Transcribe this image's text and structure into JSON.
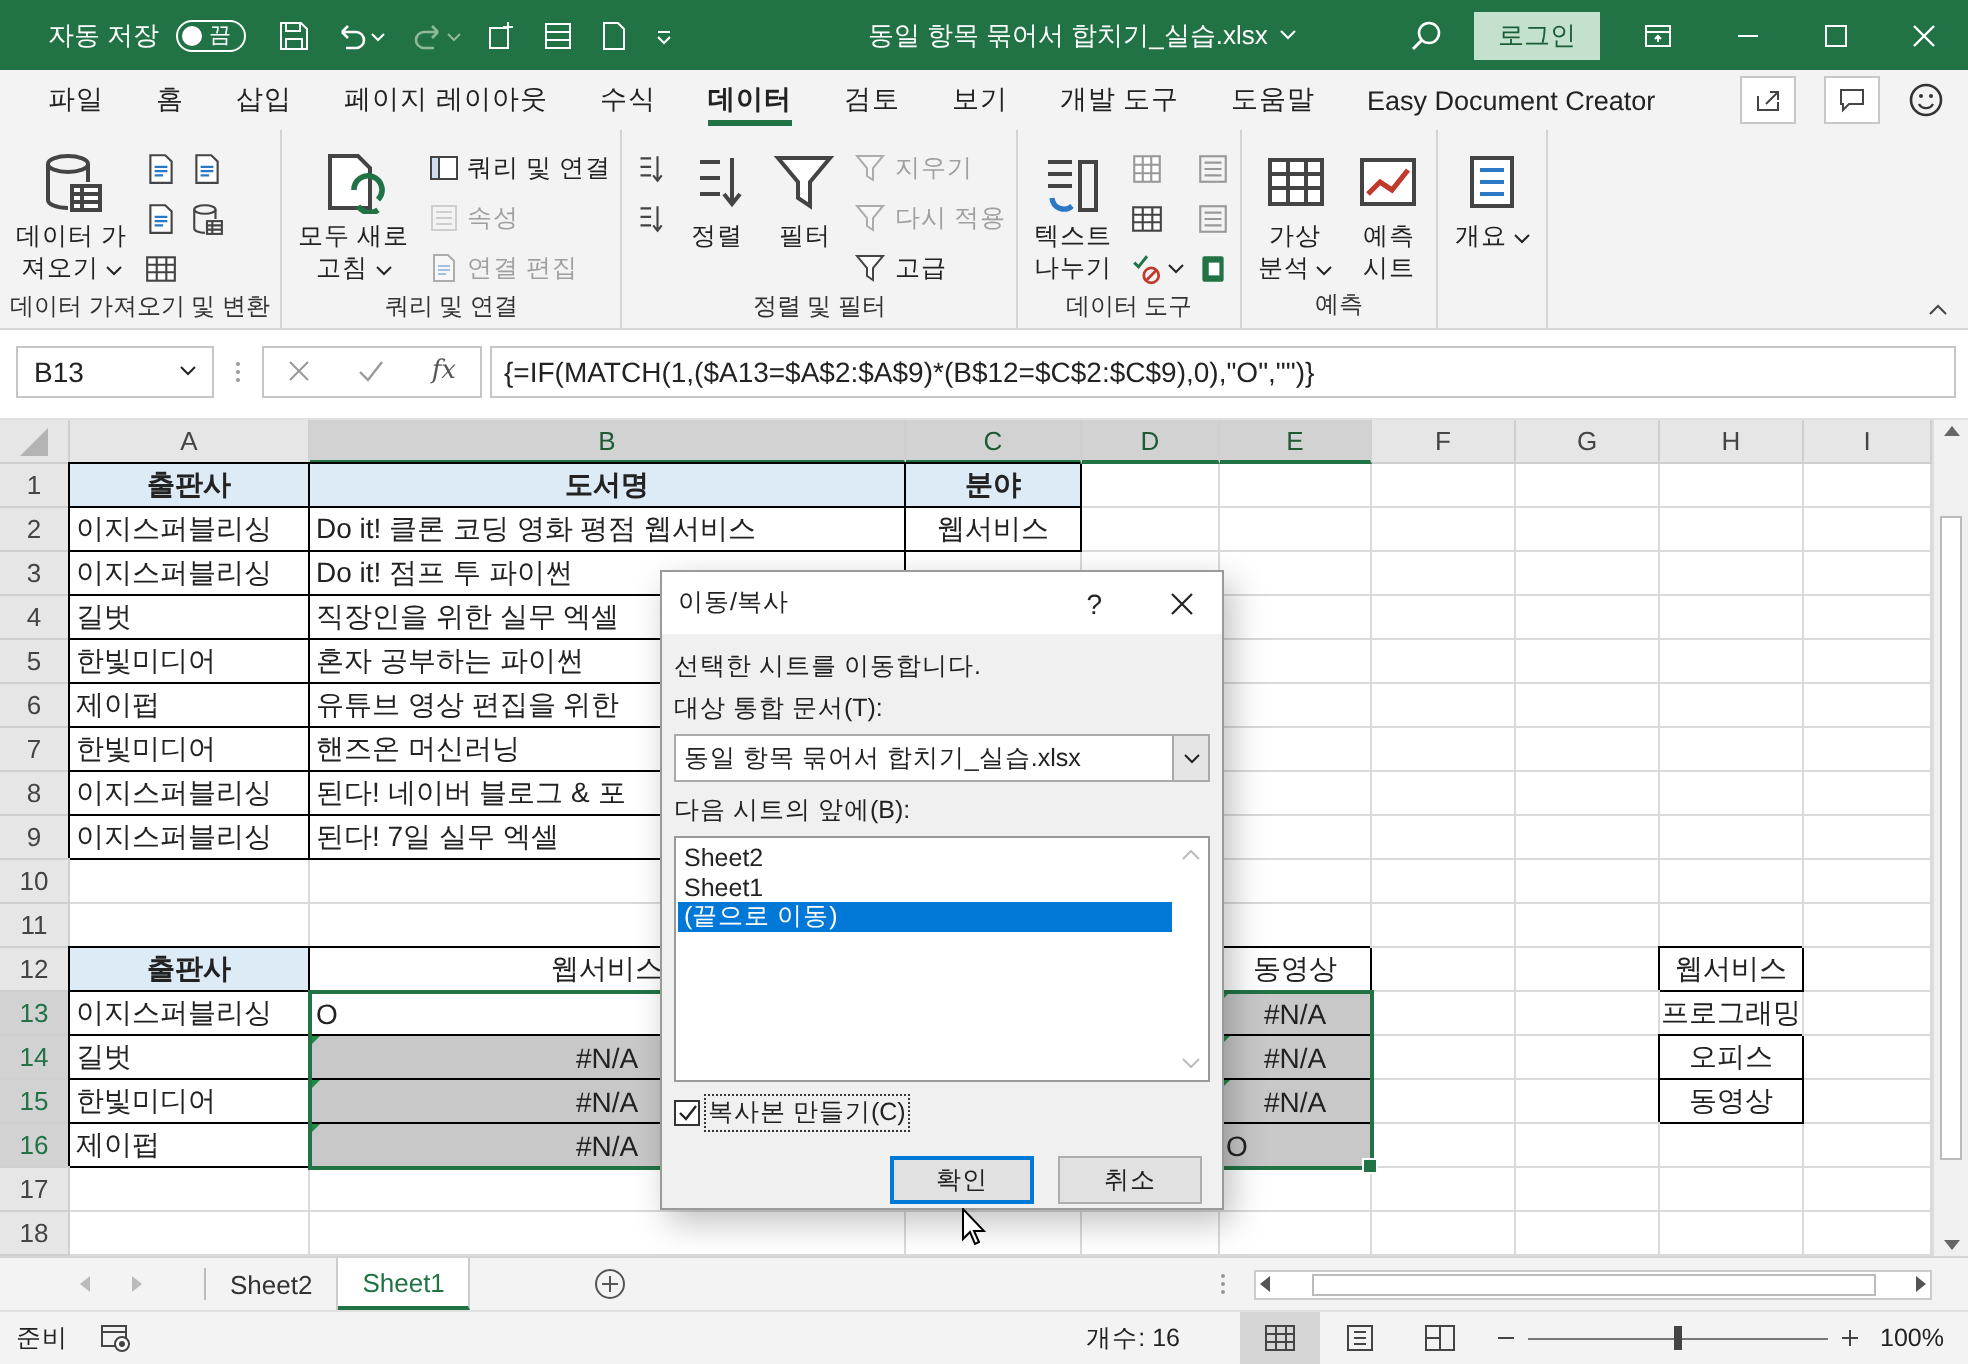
{
  "title_bar": {
    "autosave_label": "자동 저장",
    "autosave_toggle": {
      "label": "끔",
      "on": false
    },
    "document_title": "동일 항목 묶어서 합치기_실습.xlsx",
    "login_button": "로그인"
  },
  "menu_tabs": [
    {
      "label": "파일",
      "selected": false
    },
    {
      "label": "홈",
      "selected": false
    },
    {
      "label": "삽입",
      "selected": false
    },
    {
      "label": "페이지 레이아웃",
      "selected": false
    },
    {
      "label": "수식",
      "selected": false
    },
    {
      "label": "데이터",
      "selected": true
    },
    {
      "label": "검토",
      "selected": false
    },
    {
      "label": "보기",
      "selected": false
    },
    {
      "label": "개발 도구",
      "selected": false
    },
    {
      "label": "도움말",
      "selected": false
    },
    {
      "label": "Easy Document Creator",
      "selected": false
    }
  ],
  "ribbon": {
    "groups": [
      {
        "label": "데이터 가져오기 및 변환",
        "columns": [
          [
            {
              "kind": "large",
              "lines": [
                "데이터 가",
                "져오기"
              ],
              "caret": true,
              "disabled": false
            }
          ],
          [
            {
              "kind": "icon",
              "caret": false,
              "disabled": false
            },
            {
              "kind": "icon",
              "caret": false,
              "disabled": false
            },
            {
              "kind": "icon",
              "caret": false,
              "disabled": false
            }
          ],
          [
            {
              "kind": "icon",
              "caret": false,
              "disabled": false
            },
            {
              "kind": "icon",
              "caret": false,
              "disabled": false
            }
          ]
        ]
      },
      {
        "label": "쿼리 및 연결",
        "columns": [
          [
            {
              "kind": "large",
              "lines": [
                "모두 새로",
                "고침"
              ],
              "caret": true,
              "disabled": false
            }
          ],
          [
            {
              "kind": "small",
              "label": "쿼리 및 연결",
              "caret": false,
              "disabled": false
            },
            {
              "kind": "small",
              "label": "속성",
              "caret": false,
              "disabled": true
            },
            {
              "kind": "small",
              "label": "연결 편집",
              "caret": false,
              "disabled": true
            }
          ]
        ]
      },
      {
        "label": "정렬 및 필터",
        "columns": [
          [
            {
              "kind": "icon",
              "caret": false,
              "disabled": false
            },
            {
              "kind": "icon",
              "caret": false,
              "disabled": false
            }
          ],
          [
            {
              "kind": "large",
              "lines": [
                "정렬"
              ],
              "caret": false,
              "disabled": false
            }
          ],
          [
            {
              "kind": "large",
              "lines": [
                "필터"
              ],
              "caret": false,
              "disabled": false
            }
          ],
          [
            {
              "kind": "small",
              "label": "지우기",
              "caret": false,
              "disabled": true
            },
            {
              "kind": "small",
              "label": "다시 적용",
              "caret": false,
              "disabled": true
            },
            {
              "kind": "small",
              "label": "고급",
              "caret": false,
              "disabled": false
            }
          ]
        ]
      },
      {
        "label": "데이터 도구",
        "columns": [
          [
            {
              "kind": "large",
              "lines": [
                "텍스트",
                "나누기"
              ],
              "caret": false,
              "disabled": false
            }
          ],
          [
            {
              "kind": "icon",
              "caret": false,
              "disabled": false
            },
            {
              "kind": "icon",
              "caret": false,
              "disabled": false
            },
            {
              "kind": "icon",
              "caret": true,
              "disabled": false
            }
          ],
          [
            {
              "kind": "icon",
              "caret": false,
              "disabled": false
            },
            {
              "kind": "icon",
              "caret": false,
              "disabled": false
            },
            {
              "kind": "icon",
              "caret": false,
              "disabled": false
            }
          ]
        ]
      },
      {
        "label": "예측",
        "columns": [
          [
            {
              "kind": "large",
              "lines": [
                "가상",
                "분석"
              ],
              "caret": true,
              "disabled": false
            }
          ],
          [
            {
              "kind": "large",
              "lines": [
                "예측",
                "시트"
              ],
              "caret": false,
              "disabled": false
            }
          ]
        ]
      },
      {
        "columns": [
          [
            {
              "kind": "large",
              "lines": [
                "개요"
              ],
              "caret": true,
              "disabled": false
            }
          ]
        ]
      }
    ]
  },
  "formula_bar": {
    "name_box": "B13",
    "function_button": "fx",
    "formula": "{=IF(MATCH(1,($A13=$A$2:$A$9)*(B$12=$C$2:$C$9),0),\"O\",\"\")}"
  },
  "grid": {
    "column_headers": [
      {
        "label": "A",
        "selected": false
      },
      {
        "label": "B",
        "selected": true
      },
      {
        "label": "C",
        "selected": true
      },
      {
        "label": "D",
        "selected": true
      },
      {
        "label": "E",
        "selected": true
      },
      {
        "label": "F",
        "selected": false
      },
      {
        "label": "G",
        "selected": false
      },
      {
        "label": "H",
        "selected": false
      },
      {
        "label": "I",
        "selected": false
      }
    ],
    "rows": [
      {
        "number": "1",
        "selected": false,
        "a": {
          "kind": "header",
          "text": "출판사"
        },
        "b": {
          "kind": "header",
          "text": "도서명"
        },
        "c": {
          "kind": "header",
          "text": "분야"
        }
      },
      {
        "number": "2",
        "selected": false,
        "a": {
          "kind": "text",
          "text": "이지스퍼블리싱"
        },
        "b": {
          "kind": "text",
          "text": "Do it! 클론 코딩 영화 평점 웹서비스"
        },
        "c": {
          "kind": "center",
          "text": "웹서비스"
        }
      },
      {
        "number": "3",
        "selected": false,
        "a": {
          "kind": "text",
          "text": "이지스퍼블리싱"
        },
        "b": {
          "kind": "text",
          "text": "Do it! 점프 투 파이썬"
        }
      },
      {
        "number": "4",
        "selected": false,
        "a": {
          "kind": "text",
          "text": "길벗"
        },
        "b": {
          "kind": "text",
          "text": "직장인을 위한 실무 엑셀"
        }
      },
      {
        "number": "5",
        "selected": false,
        "a": {
          "kind": "text",
          "text": "한빛미디어"
        },
        "b": {
          "kind": "text",
          "text": "혼자 공부하는 파이썬"
        }
      },
      {
        "number": "6",
        "selected": false,
        "a": {
          "kind": "text",
          "text": "제이펍"
        },
        "b": {
          "kind": "text",
          "text": "유튜브 영상 편집을 위한"
        }
      },
      {
        "number": "7",
        "selected": false,
        "a": {
          "kind": "text",
          "text": "한빛미디어"
        },
        "b": {
          "kind": "text",
          "text": "핸즈온 머신러닝"
        }
      },
      {
        "number": "8",
        "selected": false,
        "a": {
          "kind": "text",
          "text": "이지스퍼블리싱"
        },
        "b": {
          "kind": "text",
          "text": "된다! 네이버 블로그 & 포"
        }
      },
      {
        "number": "9",
        "selected": false,
        "a": {
          "kind": "text",
          "text": "이지스퍼블리싱"
        },
        "b": {
          "kind": "text",
          "text": "된다! 7일 실무 엑셀"
        }
      },
      {
        "number": "10",
        "selected": false
      },
      {
        "number": "11",
        "selected": false
      },
      {
        "number": "12",
        "selected": false,
        "a": {
          "kind": "header",
          "text": "출판사"
        },
        "b": {
          "kind": "center",
          "text": "웹서비스"
        },
        "e": {
          "kind": "center",
          "text": "동영상"
        },
        "h": {
          "kind": "center",
          "text": "웹서비스"
        }
      },
      {
        "number": "13",
        "selected": true,
        "a": {
          "kind": "text",
          "text": "이지스퍼블리싱"
        },
        "b": {
          "kind": "result",
          "text": "O",
          "shaded": false,
          "flagged": false
        },
        "e": {
          "kind": "error",
          "text": "#N/A",
          "shaded": true,
          "flagged": true
        },
        "h": {
          "kind": "loose",
          "text": "프로그래밍"
        }
      },
      {
        "number": "14",
        "selected": true,
        "a": {
          "kind": "text",
          "text": "길벗"
        },
        "b": {
          "kind": "error",
          "text": "#N/A",
          "shaded": true,
          "flagged": true
        },
        "e": {
          "kind": "error",
          "text": "#N/A",
          "shaded": true,
          "flagged": true
        },
        "h": {
          "kind": "center",
          "text": "오피스"
        }
      },
      {
        "number": "15",
        "selected": true,
        "a": {
          "kind": "text",
          "text": "한빛미디어"
        },
        "b": {
          "kind": "error",
          "text": "#N/A",
          "shaded": true,
          "flagged": true
        },
        "e": {
          "kind": "error",
          "text": "#N/A",
          "shaded": true,
          "flagged": true
        },
        "h": {
          "kind": "center",
          "text": "동영상"
        }
      },
      {
        "number": "16",
        "selected": true,
        "a": {
          "kind": "text",
          "text": "제이펍"
        },
        "b": {
          "kind": "error",
          "text": "#N/A",
          "shaded": true,
          "flagged": true
        },
        "e": {
          "kind": "result",
          "text": "O",
          "shaded": true,
          "flagged": false
        }
      },
      {
        "number": "17",
        "selected": false
      },
      {
        "number": "18",
        "selected": false
      }
    ]
  },
  "sheet_tabs": [
    {
      "label": "Sheet2",
      "selected": false
    },
    {
      "label": "Sheet1",
      "selected": true
    }
  ],
  "status_bar": {
    "mode": "준비",
    "count": "개수: 16",
    "views": [
      {
        "selected": true
      },
      {
        "selected": false
      },
      {
        "selected": false
      }
    ],
    "zoom_slider": {
      "level": 0.5
    },
    "zoom": "100%"
  },
  "dialog": {
    "title": "이동/복사",
    "help": "?",
    "message": "선택한 시트를 이동합니다.",
    "workbook_label": "대상 통합 문서(T):",
    "workbook_value": "동일 항목 묶어서 합치기_실습.xlsx",
    "before_label": "다음 시트의 앞에(B):",
    "sheets": [
      {
        "label": "Sheet2",
        "selected": false
      },
      {
        "label": "Sheet1",
        "selected": false
      },
      {
        "label": "(끝으로 이동)",
        "selected": true
      }
    ],
    "copy_checkbox": {
      "label": "복사본 만들기(C)",
      "checked": true
    },
    "ok_button": "확인",
    "cancel_button": "취소"
  }
}
